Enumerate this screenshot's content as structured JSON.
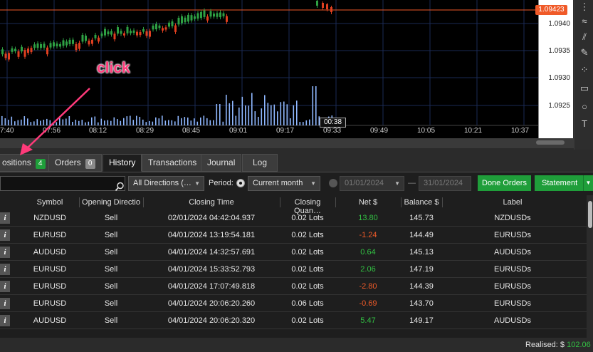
{
  "chart": {
    "price_ticks": [
      "1.0940",
      "1.0935",
      "1.0930",
      "1.0925"
    ],
    "current_price": "1.09423",
    "time_ticks": [
      "7:40",
      "07:56",
      "08:12",
      "08:29",
      "08:45",
      "09:01",
      "09:17",
      "09:33",
      "09:49",
      "10:05",
      "10:21",
      "10:37"
    ],
    "cursor_time": "00:38",
    "colors": {
      "bull": "#2ea043",
      "bear": "#e04020",
      "volume": "#8fb8ff",
      "price_line": "#f05a28"
    }
  },
  "annotation": {
    "text": "click",
    "color": "#ff3a7a"
  },
  "tabs": [
    {
      "label": "ositions",
      "badge": "4"
    },
    {
      "label": "Orders",
      "badge": "0"
    },
    {
      "label": "History"
    },
    {
      "label": "Transactions"
    },
    {
      "label": "Journal"
    },
    {
      "label": "Log"
    }
  ],
  "filters": {
    "direction": "All Directions (…",
    "period_label": "Period:",
    "period_value": "Current month",
    "date_from": "01/01/2024",
    "date_sep": "—",
    "date_to": "31/01/2024",
    "done_orders": "Done Orders",
    "statement": "Statement"
  },
  "table": {
    "columns": [
      "Symbol",
      "Opening Directio",
      "Closing Time",
      "Closing Quan…",
      "Net $",
      "Balance $",
      "Label"
    ],
    "rows": [
      {
        "symbol": "NZDUSD",
        "dir": "Sell",
        "time": "02/01/2024 04:42:04.937",
        "qty": "0.02 Lots",
        "net": "13.80",
        "sign": "pos",
        "balance": "145.73",
        "label": "NZDUSDs"
      },
      {
        "symbol": "EURUSD",
        "dir": "Sell",
        "time": "04/01/2024 13:19:54.181",
        "qty": "0.02 Lots",
        "net": "-1.24",
        "sign": "neg",
        "balance": "144.49",
        "label": "EURUSDs"
      },
      {
        "symbol": "AUDUSD",
        "dir": "Sell",
        "time": "04/01/2024 14:32:57.691",
        "qty": "0.02 Lots",
        "net": "0.64",
        "sign": "pos",
        "balance": "145.13",
        "label": "AUDUSDs"
      },
      {
        "symbol": "EURUSD",
        "dir": "Sell",
        "time": "04/01/2024 15:33:52.793",
        "qty": "0.02 Lots",
        "net": "2.06",
        "sign": "pos",
        "balance": "147.19",
        "label": "EURUSDs"
      },
      {
        "symbol": "EURUSD",
        "dir": "Sell",
        "time": "04/01/2024 17:07:49.818",
        "qty": "0.02 Lots",
        "net": "-2.80",
        "sign": "neg",
        "balance": "144.39",
        "label": "EURUSDs"
      },
      {
        "symbol": "EURUSD",
        "dir": "Sell",
        "time": "04/01/2024 20:06:20.260",
        "qty": "0.06 Lots",
        "net": "-0.69",
        "sign": "neg",
        "balance": "143.70",
        "label": "EURUSDs"
      },
      {
        "symbol": "AUDUSD",
        "dir": "Sell",
        "time": "04/01/2024 20:06:20.320",
        "qty": "0.02 Lots",
        "net": "5.47",
        "sign": "pos",
        "balance": "149.17",
        "label": "AUDUSDs"
      }
    ]
  },
  "footer": {
    "realised_label": "Realised:",
    "currency": "$",
    "realised_value": "102.06"
  }
}
